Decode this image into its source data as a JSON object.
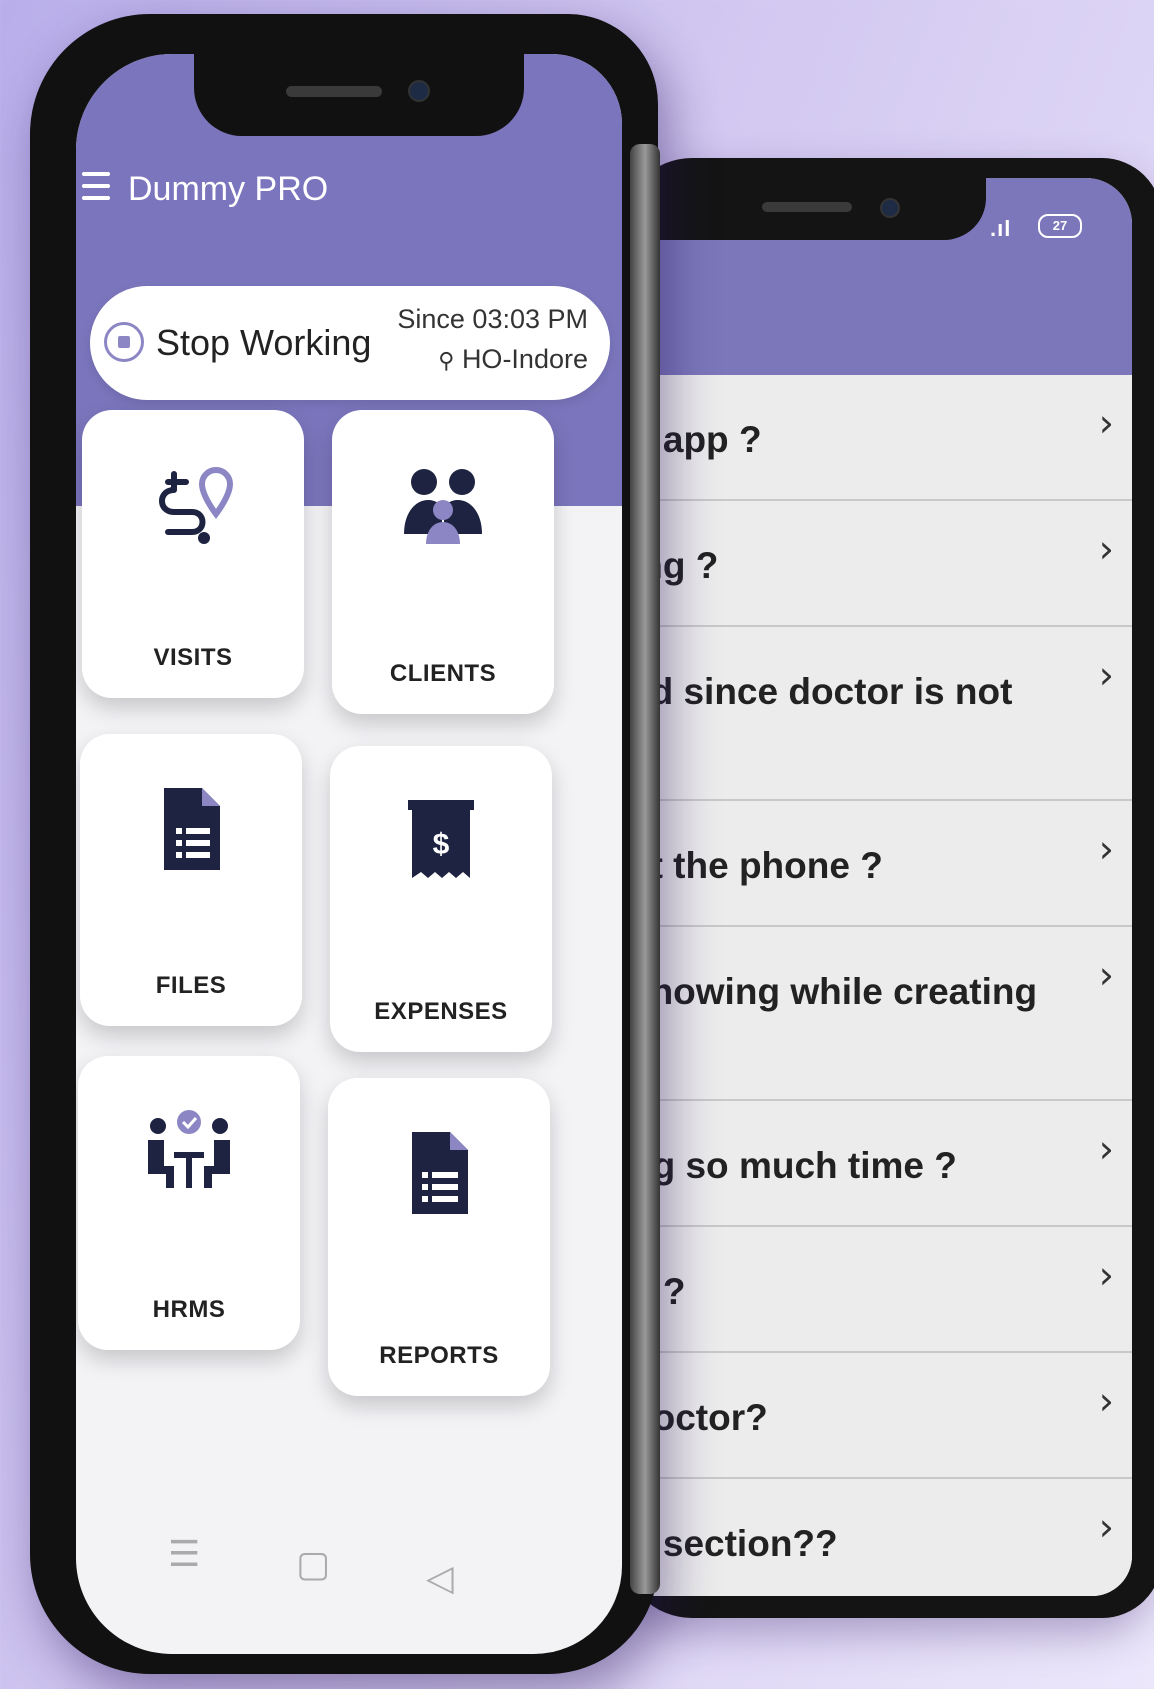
{
  "left_app": {
    "title": "Dummy PRO",
    "status": {
      "action": "Stop Working",
      "since": "Since 03:03 PM",
      "location": "HO-Indore"
    },
    "tiles": [
      {
        "label": "VISITS",
        "icon": "route-pin-icon"
      },
      {
        "label": "CLIENTS",
        "icon": "people-group-icon"
      },
      {
        "label": "FILES",
        "icon": "document-icon"
      },
      {
        "label": "EXPENSES",
        "icon": "receipt-dollar-icon"
      },
      {
        "label": "HRMS",
        "icon": "hr-meeting-icon"
      },
      {
        "label": "REPORTS",
        "icon": "report-document-icon"
      }
    ],
    "nav": {
      "menu": "☰",
      "home": "▢",
      "back": "◁"
    }
  },
  "right_app": {
    "status": {
      "signal": ".ıl",
      "battery": "27"
    },
    "faq": [
      "n app ?",
      "ing ?",
      "ed since doctor is not",
      "at the phone ?",
      "showing while creating",
      "ng so much time ?",
      "n ?",
      "doctor?",
      "d section??"
    ]
  },
  "colors": {
    "header": "#7b75bd",
    "icon_navy": "#1d2340",
    "background": "#c8bef0"
  }
}
